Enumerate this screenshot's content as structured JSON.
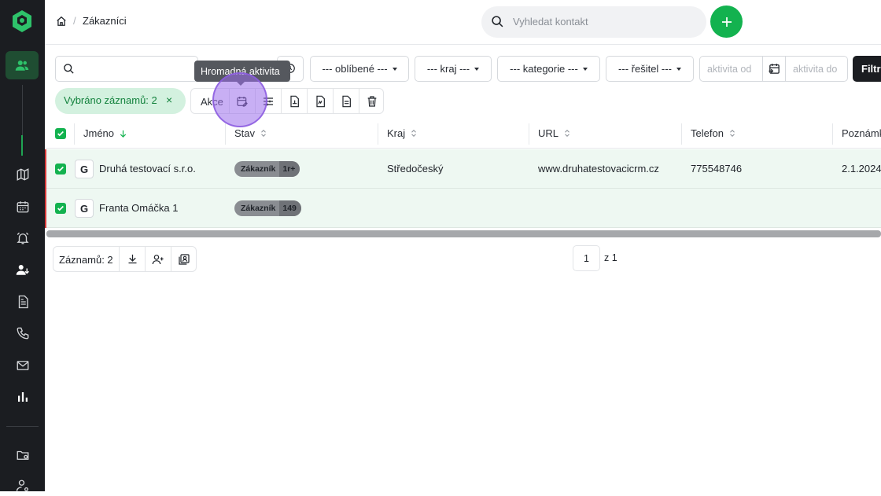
{
  "breadcrumb": {
    "title": "Zákazníci"
  },
  "search": {
    "placeholder": "Vyhledat kontakt"
  },
  "filters": {
    "favorites": "--- oblíbené ---",
    "region": "--- kraj ---",
    "category": "--- kategorie ---",
    "assignee": "--- řešitel ---",
    "activity_from": "aktivita od",
    "activity_to": "aktivita do",
    "submit_label": "Filtr"
  },
  "selection": {
    "label": "Vybráno záznamů: 2",
    "clear": "×"
  },
  "actions": {
    "label": "Akce",
    "tooltip": "Hromadná aktivita"
  },
  "table": {
    "columns": [
      "Jméno",
      "Stav",
      "Kraj",
      "URL",
      "Telefon",
      "Poznámka"
    ],
    "rows": [
      {
        "name": "Druhá testovací s.r.o.",
        "status": "Zákazník",
        "status_count": "1r+",
        "region": "Středočeský",
        "url": "www.druhatestovacicrm.cz",
        "phone": "775548746",
        "note": "2.1.2024"
      },
      {
        "name": "Franta Omáčka 1",
        "status": "Zákazník",
        "status_count": "149",
        "region": "",
        "url": "",
        "phone": "",
        "note": ""
      }
    ]
  },
  "footer": {
    "records": "Záznamů: 2",
    "page": "1",
    "page_of": "z 1"
  },
  "colors": {
    "accent": "#13b24f",
    "sidebar": "#1b1d21",
    "selection_bg": "#d3f1df"
  }
}
